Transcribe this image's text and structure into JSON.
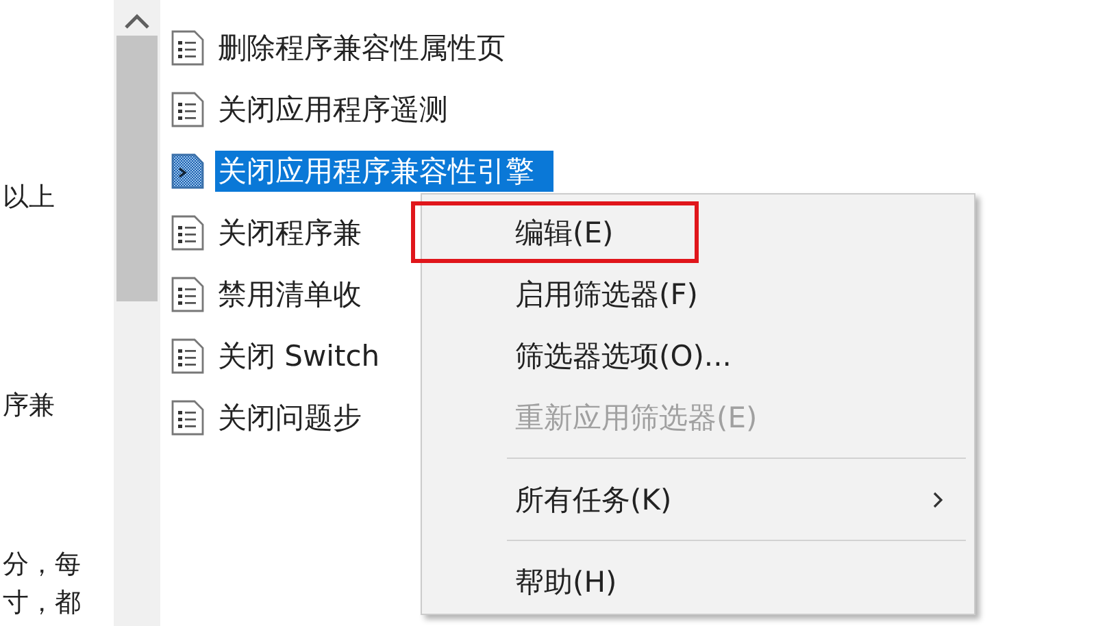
{
  "left_text": [
    "以上",
    "序兼",
    "分，每",
    "寸，都"
  ],
  "list": {
    "items": [
      {
        "label": "删除程序兼容性属性页",
        "selected": false
      },
      {
        "label": "关闭应用程序遥测",
        "selected": false
      },
      {
        "label": "关闭应用程序兼容性引擎",
        "selected": true
      },
      {
        "label": "关闭程序兼",
        "selected": false
      },
      {
        "label": "禁用清单收",
        "selected": false
      },
      {
        "label": "关闭 Switch",
        "selected": false
      },
      {
        "label": "关闭问题步",
        "selected": false
      }
    ]
  },
  "context_menu": {
    "items": [
      {
        "kind": "item",
        "label": "编辑(E)",
        "highlighted": true,
        "disabled": false,
        "submenu": false
      },
      {
        "kind": "item",
        "label": "启用筛选器(F)",
        "highlighted": false,
        "disabled": false,
        "submenu": false
      },
      {
        "kind": "item",
        "label": "筛选器选项(O)...",
        "highlighted": false,
        "disabled": false,
        "submenu": false
      },
      {
        "kind": "item",
        "label": "重新应用筛选器(E)",
        "highlighted": false,
        "disabled": true,
        "submenu": false
      },
      {
        "kind": "separator"
      },
      {
        "kind": "item",
        "label": "所有任务(K)",
        "highlighted": false,
        "disabled": false,
        "submenu": true
      },
      {
        "kind": "separator"
      },
      {
        "kind": "item",
        "label": "帮助(H)",
        "highlighted": false,
        "disabled": false,
        "submenu": false
      }
    ]
  }
}
